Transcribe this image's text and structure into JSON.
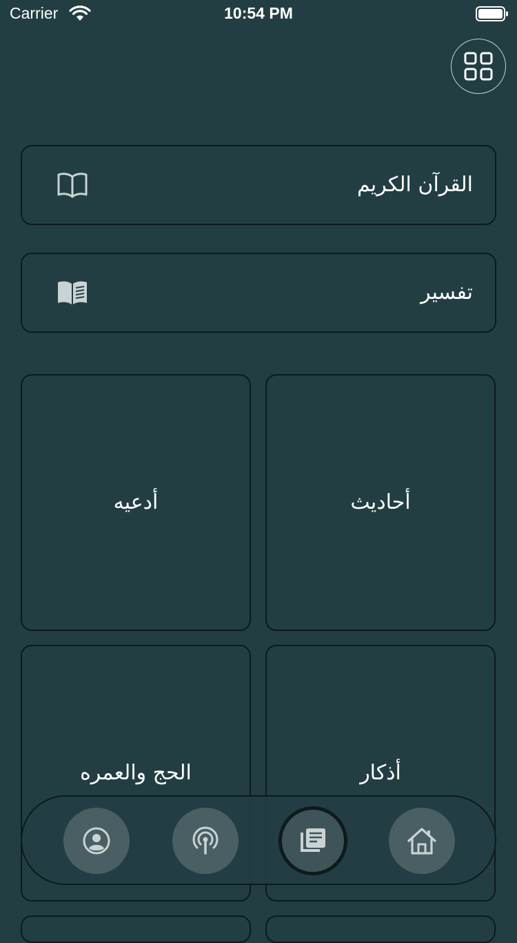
{
  "status_bar": {
    "carrier": "Carrier",
    "time": "10:54 PM"
  },
  "header": {
    "menu_icon": "grid-icon"
  },
  "cards": {
    "quran": {
      "label": "القرآن الكريم",
      "icon": "open-book-icon"
    },
    "tafsir": {
      "label": "تفسير",
      "icon": "book-reader-icon"
    }
  },
  "tiles": {
    "ahadith": "أحاديث",
    "adiyah": "أدعيه",
    "azkar": "أذكار",
    "hajj_umrah": "الحج والعمره"
  },
  "bottom_nav": {
    "items": [
      {
        "icon": "home-icon",
        "active": false
      },
      {
        "icon": "library-icon",
        "active": true
      },
      {
        "icon": "broadcast-icon",
        "active": false
      },
      {
        "icon": "profile-icon",
        "active": false
      }
    ]
  },
  "colors": {
    "background": "#223e43",
    "card_border": "#0d1a1c",
    "nav_button": "#4a5f63",
    "icon": "#c9d3d4"
  }
}
